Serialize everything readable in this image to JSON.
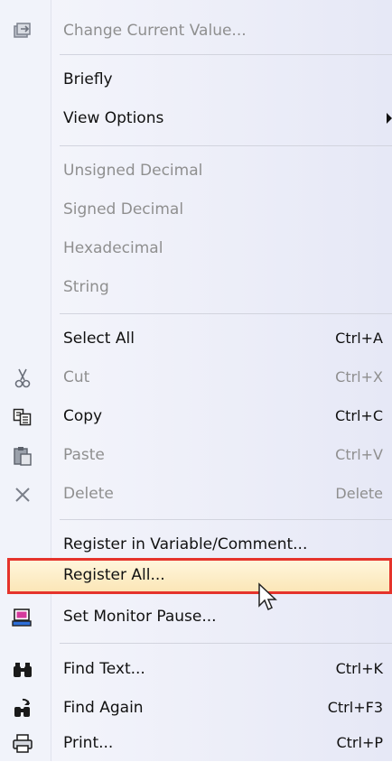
{
  "menu": {
    "change_value": {
      "label": "Change Current Value...",
      "icon": "edit-value-icon"
    },
    "briefly": {
      "label": "Briefly"
    },
    "view_options": {
      "label": "View Options"
    },
    "unsigned_decimal": {
      "label": "Unsigned Decimal"
    },
    "signed_decimal": {
      "label": "Signed Decimal"
    },
    "hexadecimal": {
      "label": "Hexadecimal"
    },
    "string": {
      "label": "String"
    },
    "select_all": {
      "label": "Select All",
      "shortcut": "Ctrl+A"
    },
    "cut": {
      "label": "Cut",
      "shortcut": "Ctrl+X",
      "icon": "scissors-icon"
    },
    "copy": {
      "label": "Copy",
      "shortcut": "Ctrl+C",
      "icon": "copy-icon"
    },
    "paste": {
      "label": "Paste",
      "shortcut": "Ctrl+V",
      "icon": "clipboard-icon"
    },
    "delete": {
      "label": "Delete",
      "shortcut": "Delete",
      "icon": "delete-x-icon"
    },
    "register_variable": {
      "label": "Register in Variable/Comment..."
    },
    "register_all": {
      "label": "Register All..."
    },
    "set_monitor_pause": {
      "label": "Set Monitor Pause...",
      "icon": "monitor-pause-icon"
    },
    "find_text": {
      "label": "Find Text...",
      "shortcut": "Ctrl+K",
      "icon": "binoculars-icon"
    },
    "find_again": {
      "label": "Find Again",
      "shortcut": "Ctrl+F3",
      "icon": "find-again-icon"
    },
    "print": {
      "label": "Print...",
      "shortcut": "Ctrl+P",
      "icon": "printer-icon"
    }
  },
  "colors": {
    "highlight_border": "#e5332b",
    "highlight_fill": "#fbe6b7",
    "disabled_text": "#8f8f8f"
  }
}
